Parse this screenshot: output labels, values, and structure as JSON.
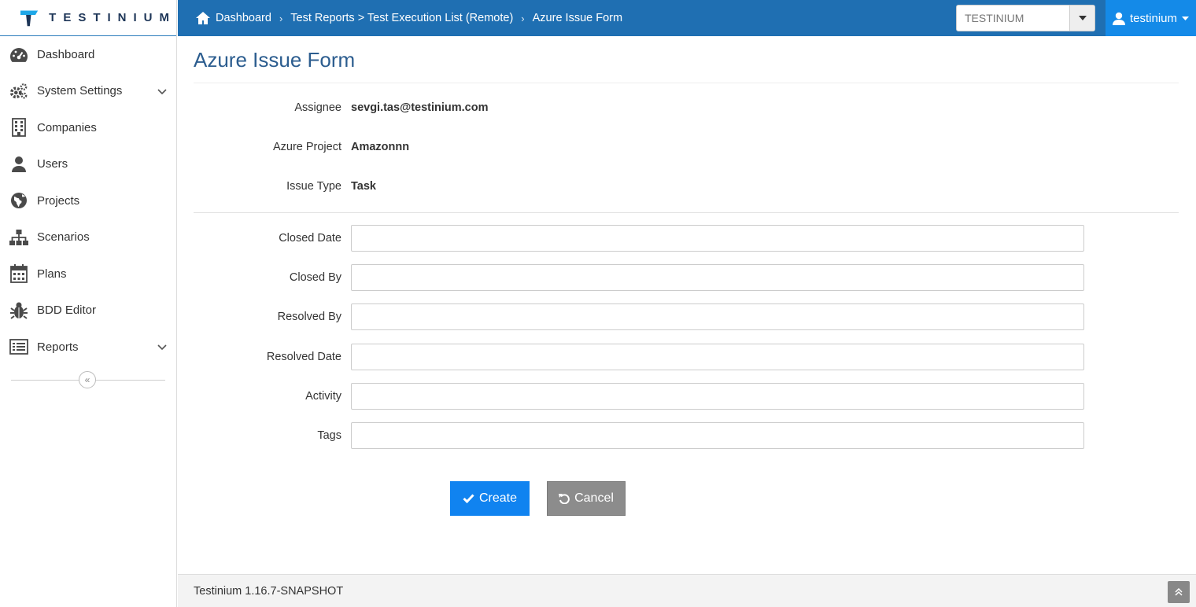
{
  "app": {
    "logo_text": "TESTINIUM"
  },
  "sidebar": {
    "items": [
      {
        "label": "Dashboard",
        "icon": "dashboard-icon",
        "has_submenu": false
      },
      {
        "label": "System Settings",
        "icon": "gears-icon",
        "has_submenu": true
      },
      {
        "label": "Companies",
        "icon": "building-icon",
        "has_submenu": false
      },
      {
        "label": "Users",
        "icon": "user-icon",
        "has_submenu": false
      },
      {
        "label": "Projects",
        "icon": "globe-icon",
        "has_submenu": false
      },
      {
        "label": "Scenarios",
        "icon": "sitemap-icon",
        "has_submenu": false
      },
      {
        "label": "Plans",
        "icon": "calendar-icon",
        "has_submenu": false
      },
      {
        "label": "BDD Editor",
        "icon": "bug-icon",
        "has_submenu": false
      },
      {
        "label": "Reports",
        "icon": "list-icon",
        "has_submenu": true
      }
    ],
    "collapse_glyph": "«"
  },
  "header": {
    "breadcrumb": [
      "Dashboard",
      "Test Reports > Test Execution List (Remote)",
      "Azure Issue Form"
    ],
    "company_select_value": "TESTINIUM",
    "user_name": "testinium"
  },
  "form": {
    "title": "Azure Issue Form",
    "info": [
      {
        "label": "Assignee",
        "value": "sevgi.tas@testinium.com"
      },
      {
        "label": "Azure Project",
        "value": "Amazonnn"
      },
      {
        "label": "Issue Type",
        "value": "Task"
      }
    ],
    "fields": [
      {
        "label": "Closed Date",
        "value": ""
      },
      {
        "label": "Closed By",
        "value": ""
      },
      {
        "label": "Resolved By",
        "value": ""
      },
      {
        "label": "Resolved Date",
        "value": ""
      },
      {
        "label": "Activity",
        "value": ""
      },
      {
        "label": "Tags",
        "value": ""
      }
    ],
    "create_label": "Create",
    "cancel_label": "Cancel"
  },
  "footer": {
    "version": "Testinium 1.16.7-SNAPSHOT"
  },
  "colors": {
    "topbar": "#1f6fb2",
    "user_menu": "#148ae8",
    "title": "#2c5d8f",
    "create_button": "#1083f0",
    "cancel_button": "#8c8c8c"
  }
}
